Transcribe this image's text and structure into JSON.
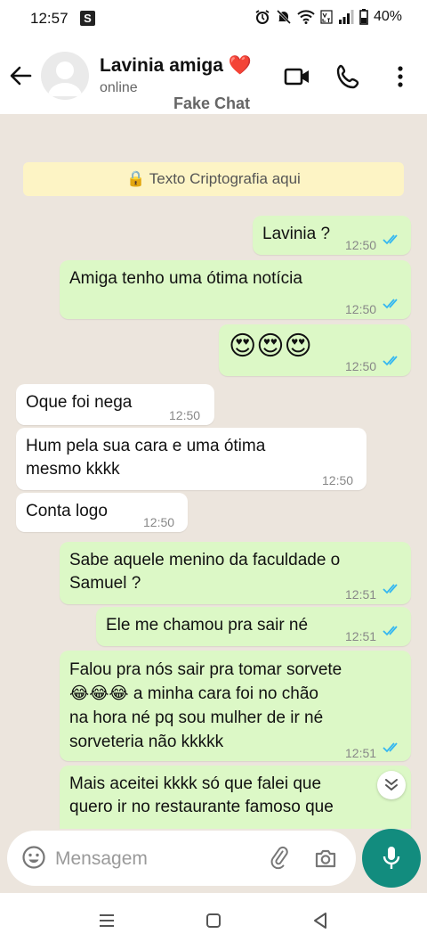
{
  "status_bar": {
    "time": "12:57",
    "s_badge": "S",
    "battery": "40%",
    "icons": [
      "alarm-icon",
      "muted-bell-icon",
      "wifi-icon",
      "volte-icon",
      "signal-icon",
      "battery-icon"
    ]
  },
  "header": {
    "contact_name": "Lavinia amiga ❤️",
    "contact_status": "online",
    "watermark": "Fake Chat",
    "icons": [
      "back-arrow-icon",
      "avatar",
      "video-call-icon",
      "voice-call-icon",
      "more-options-icon"
    ]
  },
  "chat": {
    "encryption_notice": "🔒 Texto Criptografia aqui",
    "messages": [
      {
        "direction": "outgoing",
        "text": "Lavinia ?",
        "time": "12:50",
        "status": "read"
      },
      {
        "direction": "outgoing",
        "text": "Amiga tenho uma ótima notícia",
        "time": "12:50",
        "status": "read"
      },
      {
        "direction": "outgoing",
        "text": "😍😍😍",
        "time": "12:50",
        "status": "read"
      },
      {
        "direction": "incoming",
        "text": "Oque foi nega",
        "time": "12:50"
      },
      {
        "direction": "incoming",
        "text": "Hum pela sua cara e uma ótima\nmesmo kkkk",
        "time": "12:50"
      },
      {
        "direction": "incoming",
        "text": "Conta logo",
        "time": "12:50"
      },
      {
        "direction": "outgoing",
        "text": "Sabe aquele menino da faculdade o\nSamuel ?",
        "time": "12:51",
        "status": "read"
      },
      {
        "direction": "outgoing",
        "text": "Ele me chamou pra sair né",
        "time": "12:51",
        "status": "read"
      },
      {
        "direction": "outgoing",
        "text": "Falou pra nós sair pra tomar sorvete\n😂😂😂 a minha cara foi no chão\nna hora né pq sou mulher de ir né\nsorveteria não kkkkk",
        "time": "12:51",
        "status": "read"
      },
      {
        "direction": "outgoing",
        "text": "Mais aceitei kkkk só que falei que\nquero ir no restaurante famoso que",
        "time": "",
        "status": "partial"
      }
    ],
    "scroll_down_icon": "double-chevron-down-icon",
    "read_tick_color": "#34b7f1"
  },
  "composer": {
    "placeholder": "Mensagem",
    "icons": [
      "emoji-icon",
      "attach-icon",
      "camera-icon",
      "mic-icon"
    ],
    "accent_color": "#128c7e"
  },
  "nav_bar": {
    "icons": [
      "recents-icon",
      "home-icon",
      "back-nav-icon"
    ]
  }
}
